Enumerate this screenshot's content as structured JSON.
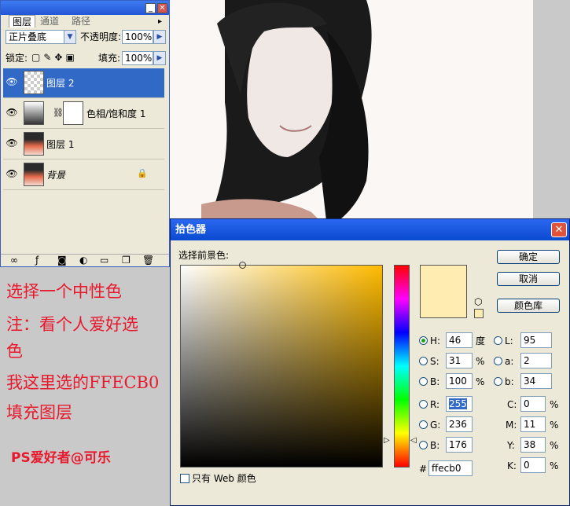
{
  "layers_panel": {
    "tabs": [
      "图层",
      "通道",
      "路径"
    ],
    "blend_mode": "正片叠底",
    "opacity_label": "不透明度:",
    "opacity_value": "100%",
    "lock_label": "锁定:",
    "fill_label": "填充:",
    "fill_value": "100%",
    "layers": [
      {
        "name": "图层 2",
        "selected": true
      },
      {
        "name": "色相/饱和度 1",
        "selected": false
      },
      {
        "name": "图层 1",
        "selected": false
      },
      {
        "name": "背景",
        "selected": false
      }
    ]
  },
  "annotation": {
    "line1": "选择一个中性色",
    "line2": "注：看个人爱好选",
    "line3": "色",
    "line4": "我这里选的FFECB0",
    "line5": "填充图层",
    "signature": "PS爱好者@可乐"
  },
  "color_picker": {
    "title": "拾色器",
    "prompt": "选择前景色:",
    "ok": "确定",
    "cancel": "取消",
    "library": "颜色库",
    "web_only": "只有 Web 颜色",
    "h_label": "H:",
    "h_value": "46",
    "h_unit": "度",
    "s_label": "S:",
    "s_value": "31",
    "s_unit": "%",
    "b_label": "B:",
    "b_value": "100",
    "b_unit": "%",
    "r_label": "R:",
    "r_value": "255",
    "g_label": "G:",
    "g_value": "236",
    "bb_label": "B:",
    "bb_value": "176",
    "l_label": "L:",
    "l_value": "95",
    "a_label": "a:",
    "a_value": "2",
    "lb_label": "b:",
    "lb_value": "34",
    "c_label": "C:",
    "c_value": "0",
    "c_unit": "%",
    "m_label": "M:",
    "m_value": "11",
    "m_unit": "%",
    "y_label": "Y:",
    "y_value": "38",
    "y_unit": "%",
    "k_label": "K:",
    "k_value": "0",
    "k_unit": "%",
    "hash": "#",
    "hex_value": "ffecb0",
    "colors": {
      "current": "#ffecb0",
      "hue_base": "#ffbb00",
      "title_bar": "#0a4ad0"
    }
  }
}
